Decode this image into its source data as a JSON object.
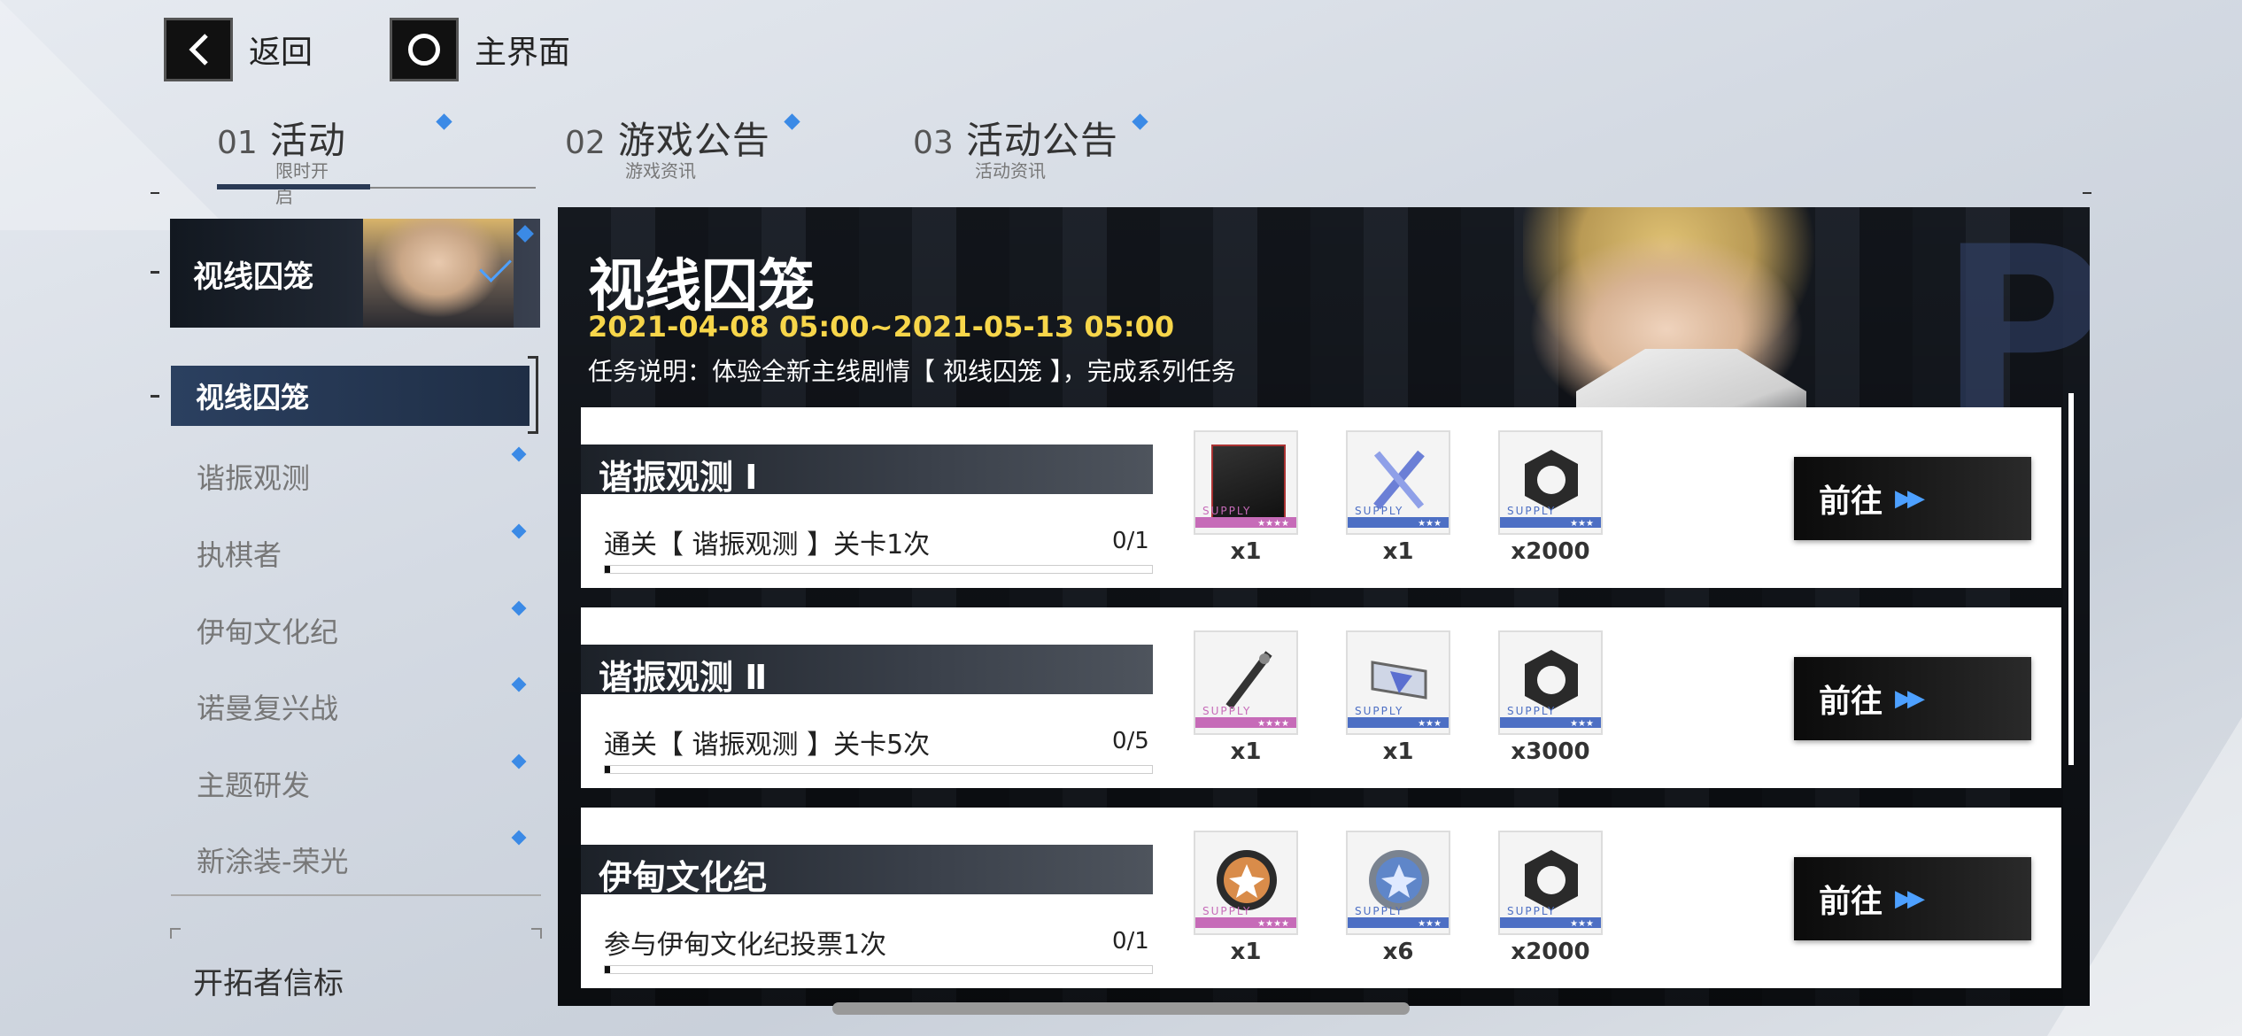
{
  "nav": {
    "back_label": "返回",
    "home_label": "主界面"
  },
  "tabs": [
    {
      "num": "01",
      "title": "活动",
      "sub": "限时开启"
    },
    {
      "num": "02",
      "title": "游戏公告",
      "sub": "游戏资讯"
    },
    {
      "num": "03",
      "title": "活动公告",
      "sub": "活动资讯"
    }
  ],
  "sidebar": {
    "banner": "视线囚笼",
    "selected": "视线囚笼",
    "items": [
      "谐振观测",
      "执棋者",
      "伊甸文化纪",
      "诺曼复兴战",
      "主题研发",
      "新涂装-荣光"
    ],
    "footer": "开拓者信标"
  },
  "event": {
    "title": "视线囚笼",
    "date": "2021-04-08 05:00~2021-05-13 05:00",
    "desc": "任务说明：体验全新主线剧情【 视线囚笼 】，完成系列任务"
  },
  "tasks": [
    {
      "name": "谐振观测 Ⅰ",
      "condition": "通关【 谐振观测 】关卡1次",
      "progress": "0/1",
      "progress_fraction": 0,
      "rewards": [
        {
          "qty": "x1",
          "supply": "SUPPLY",
          "stars": "★★★★",
          "tier": "pink",
          "icon": "book-icon"
        },
        {
          "qty": "x1",
          "supply": "SUPPLY",
          "stars": "★★★",
          "tier": "blue",
          "icon": "crystal-icon"
        },
        {
          "qty": "x2000",
          "supply": "SUPPLY",
          "stars": "★★★",
          "tier": "blue",
          "icon": "hex-nut-icon"
        }
      ],
      "button": "前往"
    },
    {
      "name": "谐振观测 Ⅱ",
      "condition": "通关【 谐振观测 】关卡5次",
      "progress": "0/5",
      "progress_fraction": 0,
      "rewards": [
        {
          "qty": "x1",
          "supply": "SUPPLY",
          "stars": "★★★★",
          "tier": "pink",
          "icon": "rod-icon"
        },
        {
          "qty": "x1",
          "supply": "SUPPLY",
          "stars": "★★★",
          "tier": "blue",
          "icon": "chip-icon"
        },
        {
          "qty": "x3000",
          "supply": "SUPPLY",
          "stars": "★★★",
          "tier": "blue",
          "icon": "hex-nut-icon"
        }
      ],
      "button": "前往"
    },
    {
      "name": "伊甸文化纪",
      "condition": "参与伊甸文化纪投票1次",
      "progress": "0/1",
      "progress_fraction": 0,
      "rewards": [
        {
          "qty": "x1",
          "supply": "SUPPLY",
          "stars": "★★★★",
          "tier": "pink",
          "icon": "orange-badge-icon"
        },
        {
          "qty": "x6",
          "supply": "SUPPLY",
          "stars": "★★★",
          "tier": "blue",
          "icon": "blue-badge-icon"
        },
        {
          "qty": "x2000",
          "supply": "SUPPLY",
          "stars": "★★★",
          "tier": "blue",
          "icon": "hex-nut-icon"
        }
      ],
      "button": "前往"
    }
  ],
  "colors": {
    "accent": "#3b8ae6",
    "date": "#f7d64a",
    "panel": "#0c0f14"
  }
}
